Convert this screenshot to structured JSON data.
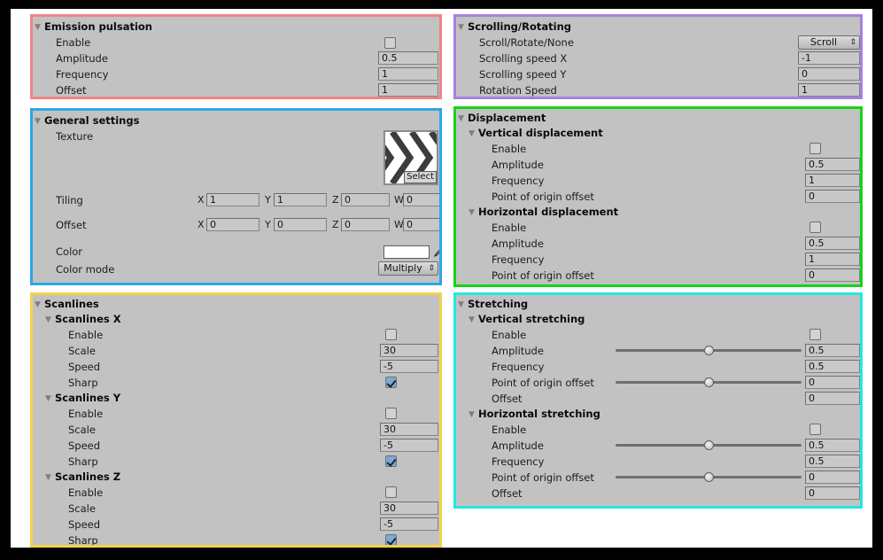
{
  "window": {
    "background": "#000000",
    "canvas_background": "#ffffff",
    "panel_background": "#c2c2c2"
  },
  "panels": {
    "emission": {
      "title": "Emission pulsation",
      "border_color": "#f08484",
      "rows": {
        "enable": {
          "label": "Enable",
          "checked": false
        },
        "amplitude": {
          "label": "Amplitude",
          "value": "0.5"
        },
        "frequency": {
          "label": "Frequency",
          "value": "1"
        },
        "offset": {
          "label": "Offset",
          "value": "1"
        }
      }
    },
    "scrolling": {
      "title": "Scrolling/Rotating",
      "border_color": "#a97fe0",
      "rows": {
        "mode": {
          "label": "Scroll/Rotate/None",
          "value": "Scroll"
        },
        "speed_x": {
          "label": "Scrolling speed X",
          "value": "-1"
        },
        "speed_y": {
          "label": "Scrolling speed Y",
          "value": "0"
        },
        "rotation": {
          "label": "Rotation Speed",
          "value": "1"
        }
      }
    },
    "general": {
      "title": "General settings",
      "border_color": "#29a7e8",
      "texture": {
        "label": "Texture",
        "select_label": "Select"
      },
      "tiling": {
        "label": "Tiling",
        "axes": [
          "X",
          "Y",
          "Z",
          "W"
        ],
        "values": [
          "1",
          "1",
          "0",
          "0"
        ]
      },
      "offset": {
        "label": "Offset",
        "axes": [
          "X",
          "Y",
          "Z",
          "W"
        ],
        "values": [
          "0",
          "0",
          "0",
          "0"
        ]
      },
      "color": {
        "label": "Color",
        "value": "#ffffff"
      },
      "color_mode": {
        "label": "Color mode",
        "value": "Multiply"
      }
    },
    "displacement": {
      "title": "Displacement",
      "border_color": "#15d415",
      "vertical": {
        "title": "Vertical displacement",
        "enable": {
          "label": "Enable",
          "checked": false
        },
        "amplitude": {
          "label": "Amplitude",
          "value": "0.5"
        },
        "frequency": {
          "label": "Frequency",
          "value": "1"
        },
        "origin": {
          "label": "Point of origin offset",
          "value": "0"
        }
      },
      "horizontal": {
        "title": "Horizontal displacement",
        "enable": {
          "label": "Enable",
          "checked": false
        },
        "amplitude": {
          "label": "Amplitude",
          "value": "0.5"
        },
        "frequency": {
          "label": "Frequency",
          "value": "1"
        },
        "origin": {
          "label": "Point of origin offset",
          "value": "0"
        }
      }
    },
    "scanlines": {
      "title": "Scanlines",
      "border_color": "#f2d24a",
      "x": {
        "title": "Scanlines X",
        "enable": {
          "label": "Enable",
          "checked": false
        },
        "scale": {
          "label": "Scale",
          "value": "30"
        },
        "speed": {
          "label": "Speed",
          "value": "-5"
        },
        "sharp": {
          "label": "Sharp",
          "checked": true
        }
      },
      "y": {
        "title": "Scanlines Y",
        "enable": {
          "label": "Enable",
          "checked": false
        },
        "scale": {
          "label": "Scale",
          "value": "30"
        },
        "speed": {
          "label": "Speed",
          "value": "-5"
        },
        "sharp": {
          "label": "Sharp",
          "checked": true
        }
      },
      "z": {
        "title": "Scanlines Z",
        "enable": {
          "label": "Enable",
          "checked": false
        },
        "scale": {
          "label": "Scale",
          "value": "30"
        },
        "speed": {
          "label": "Speed",
          "value": "-5"
        },
        "sharp": {
          "label": "Sharp",
          "checked": true
        }
      }
    },
    "stretching": {
      "title": "Stretching",
      "border_color": "#22e8e0",
      "vertical": {
        "title": "Vertical stretching",
        "enable": {
          "label": "Enable",
          "checked": false
        },
        "amplitude": {
          "label": "Amplitude",
          "value": "0.5",
          "slider": 50
        },
        "frequency": {
          "label": "Frequency",
          "value": "0.5"
        },
        "origin": {
          "label": "Point of origin offset",
          "value": "0",
          "slider": 50
        },
        "offset": {
          "label": "Offset",
          "value": "0"
        }
      },
      "horizontal": {
        "title": "Horizontal stretching",
        "enable": {
          "label": "Enable",
          "checked": false
        },
        "amplitude": {
          "label": "Amplitude",
          "value": "0.5",
          "slider": 50
        },
        "frequency": {
          "label": "Frequency",
          "value": "0.5"
        },
        "origin": {
          "label": "Point of origin offset",
          "value": "0",
          "slider": 50
        },
        "offset": {
          "label": "Offset",
          "value": "0"
        }
      }
    }
  },
  "icons": {
    "foldout": "▼",
    "dropdown_arrow": "⇕"
  }
}
